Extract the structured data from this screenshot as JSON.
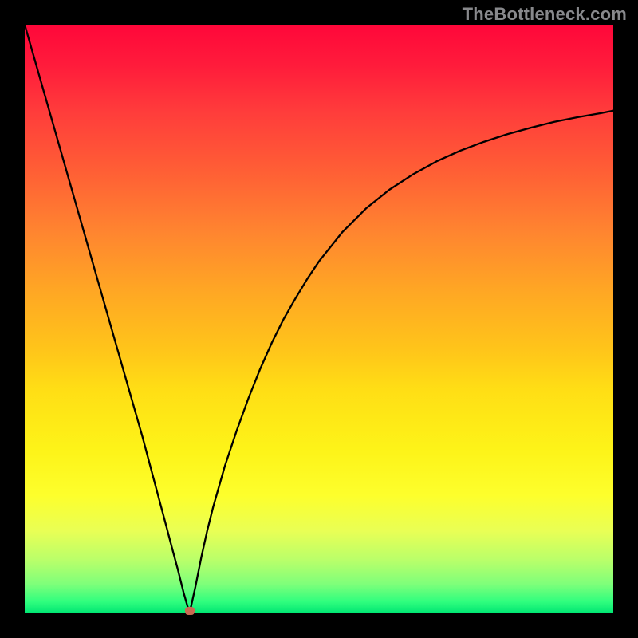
{
  "watermark": "TheBottleneck.com",
  "colors": {
    "curve_stroke": "#000000",
    "marker_fill": "#c96a52",
    "frame": "#000000"
  },
  "chart_data": {
    "type": "line",
    "title": "",
    "xlabel": "",
    "ylabel": "",
    "xlim": [
      0,
      100
    ],
    "ylim": [
      0,
      100
    ],
    "optimal_x": 28,
    "series": [
      {
        "name": "bottleneck-curve",
        "x": [
          0,
          2,
          4,
          6,
          8,
          10,
          12,
          14,
          16,
          18,
          20,
          22,
          24,
          25,
          26,
          27,
          28,
          29,
          30,
          31,
          32,
          34,
          36,
          38,
          40,
          42,
          44,
          46,
          48,
          50,
          54,
          58,
          62,
          66,
          70,
          74,
          78,
          82,
          86,
          90,
          94,
          98,
          100
        ],
        "y": [
          100,
          93,
          86,
          79,
          72,
          65,
          58,
          51,
          44,
          37,
          30,
          22.5,
          15,
          11.2,
          7.5,
          3.5,
          0,
          4.5,
          9.5,
          14,
          18,
          25,
          31,
          36.5,
          41.5,
          46,
          50,
          53.5,
          56.8,
          59.8,
          64.8,
          68.8,
          72,
          74.6,
          76.8,
          78.6,
          80.1,
          81.4,
          82.5,
          83.5,
          84.3,
          85,
          85.4
        ]
      }
    ],
    "marker": {
      "x": 28,
      "y": 0
    }
  }
}
